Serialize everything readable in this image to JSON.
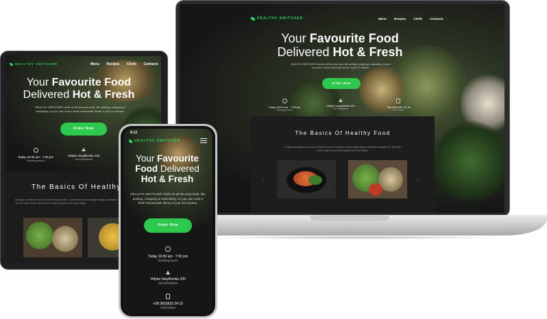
{
  "brand": "HEALTHY SWITCHER",
  "nav": [
    "Menu",
    "Recipes",
    "Chefs",
    "Contacts"
  ],
  "hero": {
    "line1_pre": "Your",
    "line1_bold": "Favourite Food",
    "line2_pre": "Delivered",
    "line2_bold": "Hot & Fresh",
    "mobile_l1_pre": "Your",
    "mobile_l1_bold": "Favourite",
    "mobile_l2_bold": "Food",
    "mobile_l2_post": "Delivered",
    "mobile_l3_bold": "Hot & Fresh",
    "text": "HEALTHY SWITCHER chefs do all the prep work, like peeling, chopping & marinating, so you can cook a fresh homemade dinner in just 15 minutes.",
    "tablet_text": "HEALTHY SWITCHER chefs do all the prep work, like peeling, chopping & marinating, so you can cook a fresh homemade dinner in just 15 minutes.",
    "button": "Order Now"
  },
  "info": {
    "hours_value": "Today 10:00 am - 7:00 pm",
    "hours_label": "Working hours",
    "address_value": "Velyka Vasylkivska 100",
    "address_label": "Get Directions",
    "phone_value": "+38 (063)633 24 15",
    "phone_label": "Call Online",
    "laptop_address_label": "Get Directions"
  },
  "basics": {
    "title": "The Basics Of Healthy Food",
    "tablet_title": "The Basics Of Healthy F",
    "text": "In aliqua ea ullamco ad est ex non deserunt nulla. Consectetur sint ea aliquip aliquip consectetur voluptate est. Eu minim dolore laboris enim mollit voluptate irure esse aliquip."
  },
  "phone": {
    "time": "8:13"
  },
  "colors": {
    "accent": "#2ec84f",
    "background": "#151716",
    "device": "#2a2a2c"
  }
}
